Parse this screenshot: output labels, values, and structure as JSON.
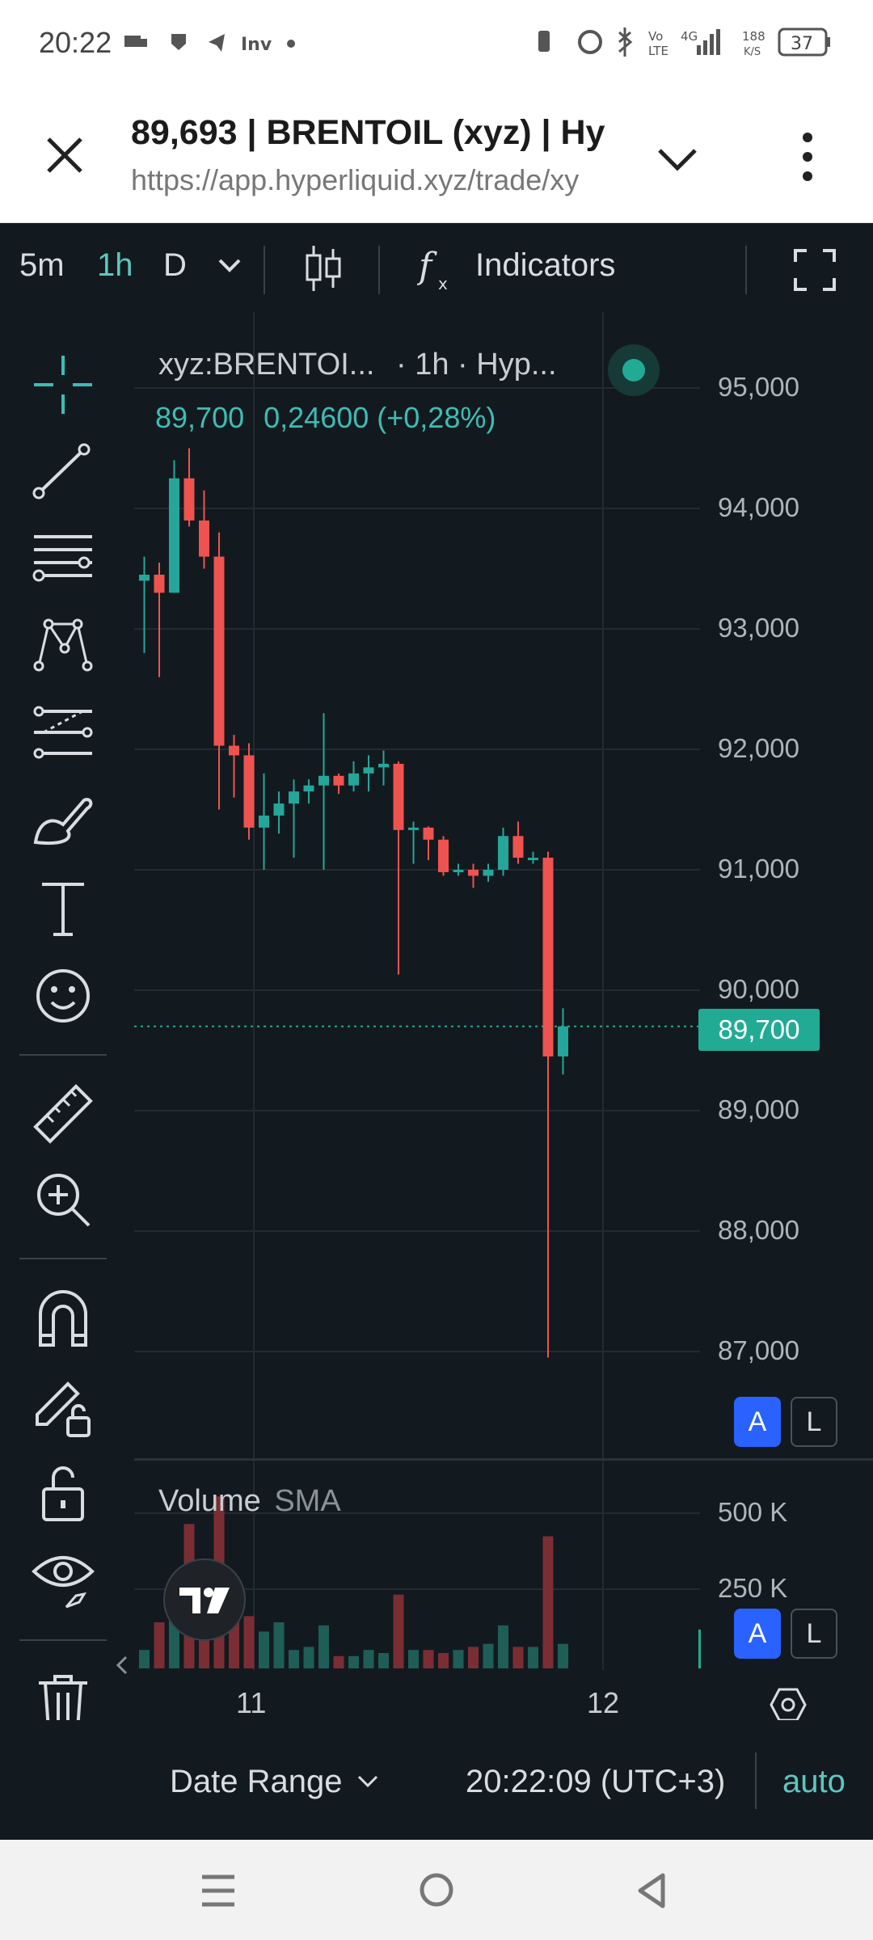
{
  "status_bar": {
    "time": "20:22",
    "net_speed": "188\nK/S",
    "battery": "37",
    "signal_text": "4G",
    "volte": "Vo\nLTE"
  },
  "browser": {
    "page_title": "89,693 | BRENTOIL (xyz) | Hy",
    "url": "https://app.hyperliquid.xyz/trade/xy"
  },
  "toolbar": {
    "intervals": [
      "5m",
      "1h",
      "D"
    ],
    "active_interval": "1h",
    "indicators_label": "Indicators"
  },
  "chart": {
    "symbol_label": "xyz:BRENTOI...",
    "interval_label": "· 1h · Hyp...",
    "last_price": "89,700",
    "change": "0,24600 (+0,28%)",
    "price_axis_labels": [
      "95,000",
      "94,000",
      "93,000",
      "92,000",
      "91,000",
      "90,000",
      "89,000",
      "88,000",
      "87,000"
    ],
    "current_price_tag": "89,700",
    "volume_label": "Volume",
    "volume_sma_label": "SMA",
    "volume_axis_labels": [
      "500 K",
      "250 K"
    ],
    "x_axis_labels": [
      "11",
      "12"
    ],
    "scale_buttons": [
      "A",
      "L"
    ],
    "colors": {
      "up": "#26a69a",
      "down": "#ef5350",
      "accent": "#2962ff",
      "tag": "#22ab94"
    }
  },
  "chart_data": {
    "type": "candlestick",
    "interval": "1h",
    "y_range": [
      86500,
      95500
    ],
    "candles": [
      {
        "o": 93400,
        "h": 93600,
        "l": 92800,
        "c": 93450
      },
      {
        "o": 93450,
        "h": 93550,
        "l": 92600,
        "c": 93300
      },
      {
        "o": 93300,
        "h": 94400,
        "l": 93300,
        "c": 94250
      },
      {
        "o": 94250,
        "h": 94500,
        "l": 93850,
        "c": 93900
      },
      {
        "o": 93900,
        "h": 94150,
        "l": 93500,
        "c": 93600
      },
      {
        "o": 93600,
        "h": 93800,
        "l": 91500,
        "c": 92030
      },
      {
        "o": 92030,
        "h": 92120,
        "l": 91600,
        "c": 91950
      },
      {
        "o": 91950,
        "h": 92050,
        "l": 91250,
        "c": 91350
      },
      {
        "o": 91350,
        "h": 91800,
        "l": 91000,
        "c": 91450
      },
      {
        "o": 91450,
        "h": 91650,
        "l": 91300,
        "c": 91550
      },
      {
        "o": 91550,
        "h": 91750,
        "l": 91100,
        "c": 91650
      },
      {
        "o": 91650,
        "h": 91750,
        "l": 91550,
        "c": 91700
      },
      {
        "o": 91700,
        "h": 92300,
        "l": 91000,
        "c": 91780
      },
      {
        "o": 91780,
        "h": 91800,
        "l": 91630,
        "c": 91700
      },
      {
        "o": 91700,
        "h": 91900,
        "l": 91650,
        "c": 91800
      },
      {
        "o": 91800,
        "h": 91950,
        "l": 91650,
        "c": 91850
      },
      {
        "o": 91850,
        "h": 91990,
        "l": 91700,
        "c": 91880
      },
      {
        "o": 91880,
        "h": 91900,
        "l": 90130,
        "c": 91330
      },
      {
        "o": 91330,
        "h": 91400,
        "l": 91050,
        "c": 91350
      },
      {
        "o": 91350,
        "h": 91360,
        "l": 91080,
        "c": 91250
      },
      {
        "o": 91250,
        "h": 91280,
        "l": 90950,
        "c": 90980
      },
      {
        "o": 90980,
        "h": 91050,
        "l": 90950,
        "c": 91000
      },
      {
        "o": 91000,
        "h": 91050,
        "l": 90850,
        "c": 90950
      },
      {
        "o": 90950,
        "h": 91050,
        "l": 90900,
        "c": 91000
      },
      {
        "o": 91000,
        "h": 91350,
        "l": 90950,
        "c": 91280
      },
      {
        "o": 91280,
        "h": 91400,
        "l": 91050,
        "c": 91100
      },
      {
        "o": 91100,
        "h": 91150,
        "l": 91050,
        "c": 91100
      },
      {
        "o": 91100,
        "h": 91150,
        "l": 86950,
        "c": 89450
      },
      {
        "o": 89450,
        "h": 89850,
        "l": 89300,
        "c": 89700
      }
    ],
    "volumes": [
      60,
      150,
      210,
      470,
      250,
      560,
      230,
      170,
      120,
      150,
      60,
      70,
      140,
      40,
      40,
      60,
      50,
      240,
      60,
      60,
      50,
      60,
      70,
      80,
      140,
      70,
      70,
      430,
      80
    ]
  },
  "bottom": {
    "date_range_label": "Date Range",
    "time_display": "20:22:09 (UTC+3)",
    "auto_label": "auto"
  }
}
